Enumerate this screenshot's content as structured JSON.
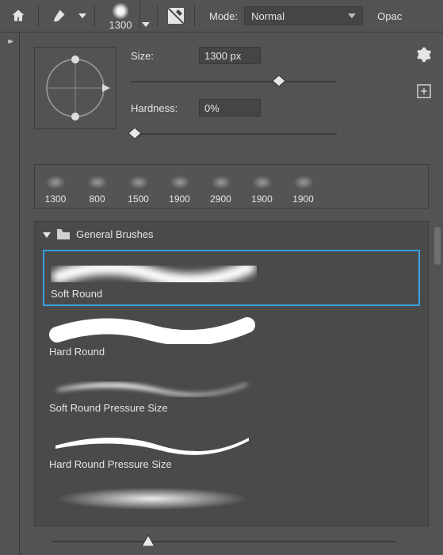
{
  "topbar": {
    "brush_size": "1300",
    "mode_label": "Mode:",
    "mode_value": "Normal",
    "opacity_label": "Opac"
  },
  "panel": {
    "size_label": "Size:",
    "size_value": "1300 px",
    "size_slider_pct": 72,
    "hardness_label": "Hardness:",
    "hardness_value": "0%",
    "hardness_slider_pct": 2
  },
  "recent": [
    {
      "size": "1300"
    },
    {
      "size": "800"
    },
    {
      "size": "1500"
    },
    {
      "size": "1900"
    },
    {
      "size": "2900"
    },
    {
      "size": "1900"
    },
    {
      "size": "1900"
    }
  ],
  "folder": {
    "name": "General Brushes",
    "items": [
      {
        "label": "Soft Round",
        "kind": "soft",
        "selected": true
      },
      {
        "label": "Hard Round",
        "kind": "hard",
        "selected": false
      },
      {
        "label": "Soft Round Pressure Size",
        "kind": "soft-pressure",
        "selected": false
      },
      {
        "label": "Hard Round Pressure Size",
        "kind": "hard-pressure",
        "selected": false
      },
      {
        "label": "",
        "kind": "glow",
        "selected": false
      }
    ]
  },
  "bottom_slider_pct": 28
}
